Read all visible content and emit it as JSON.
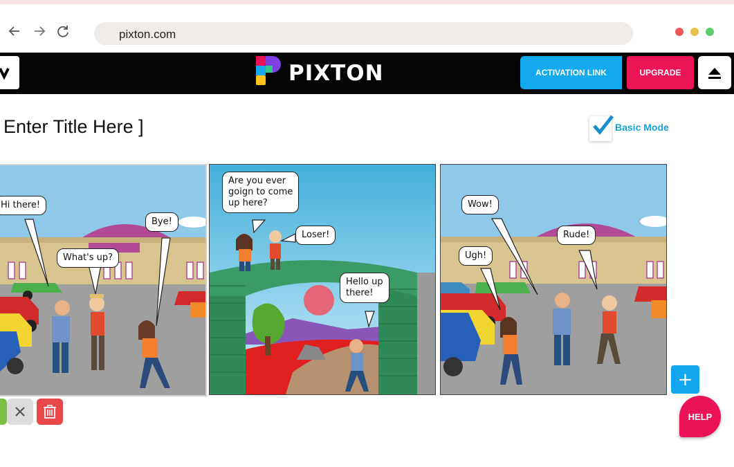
{
  "browser": {
    "url": "pixton.com",
    "window_dots": [
      "#ee5a5a",
      "#e9c14b",
      "#5dcc6a"
    ]
  },
  "appbar": {
    "logo_text": "PIXTON",
    "activation_label": "ACTIVATION LINK",
    "upgrade_label": "UPGRADE",
    "colors": {
      "activation": "#12a9ee",
      "upgrade": "#eb1555",
      "bar": "#050505"
    }
  },
  "comic": {
    "title": "[ Enter Title Here ]",
    "basic_mode_label": "Basic Mode",
    "panels": [
      {
        "bubbles": [
          "Hi there!",
          "What's up?",
          "Bye!"
        ]
      },
      {
        "bubbles": [
          "Are you ever\ngoign to come\nup here?",
          "Loser!",
          "Hello up\nthere!"
        ]
      },
      {
        "bubbles": [
          "Wow!",
          "Rude!",
          "Ugh!"
        ]
      }
    ]
  },
  "tools": {
    "icons": [
      "confirm-icon",
      "close-icon",
      "trash-icon"
    ]
  },
  "floating": {
    "add_label": "+",
    "help_label": "HELP"
  }
}
